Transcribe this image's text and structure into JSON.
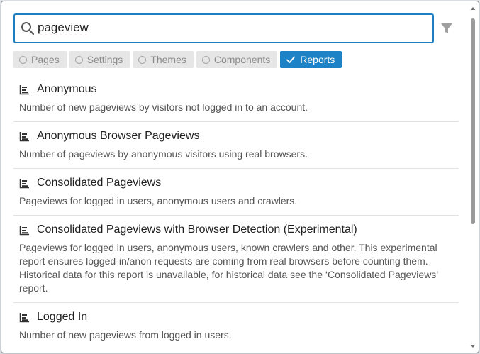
{
  "search": {
    "value": "pageview",
    "placeholder": ""
  },
  "filters": [
    {
      "label": "Pages",
      "selected": false
    },
    {
      "label": "Settings",
      "selected": false
    },
    {
      "label": "Themes",
      "selected": false
    },
    {
      "label": "Components",
      "selected": false
    },
    {
      "label": "Reports",
      "selected": true
    }
  ],
  "results": [
    {
      "title": "Anonymous",
      "description": "Number of new pageviews by visitors not logged in to an account."
    },
    {
      "title": "Anonymous Browser Pageviews",
      "description": "Number of pageviews by anonymous visitors using real browsers."
    },
    {
      "title": "Consolidated Pageviews",
      "description": "Pageviews for logged in users, anonymous users and crawlers."
    },
    {
      "title": "Consolidated Pageviews with Browser Detection (Experimental)",
      "description": "Pageviews for logged in users, anonymous users, known crawlers and other. This experimental report ensures logged-in/anon requests are coming from real browsers before counting them. Historical data for this report is unavailable, for historical data see the ‘Consolidated Pageviews’ report."
    },
    {
      "title": "Logged In",
      "description": "Number of new pageviews from logged in users."
    }
  ],
  "colors": {
    "accent": "#1d83c6",
    "search_border": "#1d7fc1",
    "chip_bg": "#e6e6e6",
    "chip_text": "#8a8a8a"
  },
  "icons": {
    "search": "search-icon",
    "filter": "filter-icon",
    "report": "bar-chart-icon",
    "check": "check-icon"
  }
}
